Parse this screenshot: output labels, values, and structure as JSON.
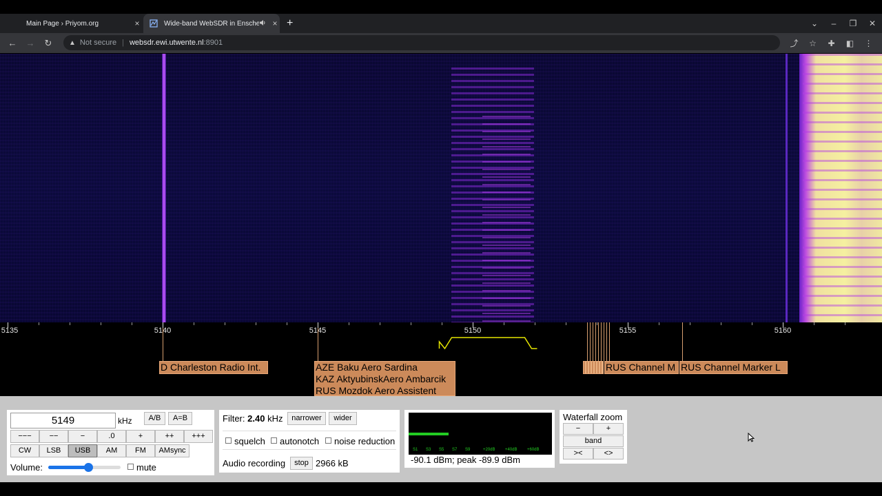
{
  "browser": {
    "tabs": [
      {
        "title": "Main Page › Priyom.org",
        "active": false,
        "close": "×"
      },
      {
        "title": "Wide-band WebSDR in Enschede",
        "active": true,
        "close": "×"
      }
    ],
    "new_tab": "+",
    "address": {
      "not_secure": "Not secure",
      "host": "websdr.ewi.utwente.nl",
      "port": ":8901"
    }
  },
  "icons": {
    "back": "back-arrow-icon",
    "forward": "forward-arrow-icon",
    "reload": "reload-icon",
    "warning": "warning-triangle-icon",
    "share": "share-icon",
    "star": "star-icon",
    "extensions": "puzzle-icon",
    "sidepanel": "side-panel-icon",
    "menu": "kebab-menu-icon",
    "speaker": "speaker-icon",
    "favicon": "websdr-favicon"
  },
  "scale": {
    "unit": "kHz",
    "min_khz": 5135,
    "max_khz": 5162.5,
    "major_ticks": [
      "5135",
      "5140",
      "5145",
      "5150",
      "5155",
      "5160"
    ],
    "passband": {
      "low_khz": 5149.1,
      "high_khz": 5151.9
    }
  },
  "stations": [
    {
      "label": "D Charleston Radio Int.",
      "freq_khz": 5140
    },
    {
      "labels": [
        "AZE Baku Aero Sardina",
        "KAZ AktyubinskAero Ambarcik",
        "RUS Mozdok Aero Assistent"
      ],
      "freq_khz": 5145
    },
    {
      "label": "RUS Channel M",
      "freq_khz": 5154
    },
    {
      "label": "RUS Channel Marker L",
      "freq_khz": 5156.3
    }
  ],
  "controls": {
    "frequency": "5149",
    "freq_unit": "kHz",
    "ab": "A/B",
    "aeqb": "A=B",
    "steps": [
      "−−−",
      "−−",
      "−",
      ".0",
      "+",
      "++",
      "+++"
    ],
    "modes": [
      "CW",
      "LSB",
      "USB",
      "AM",
      "FM",
      "AMsync"
    ],
    "active_mode": "USB",
    "volume_label": "Volume:",
    "volume_level": 0.55,
    "mute": "mute",
    "filter_label": "Filter:",
    "filter_value": "2.40",
    "filter_unit": "kHz",
    "narrower": "narrower",
    "wider": "wider",
    "squelch": "squelch",
    "autonotch": "autonotch",
    "noise_reduction": "noise reduction",
    "audio_recording": "Audio recording",
    "stop": "stop",
    "recorded_size": "2966 kB",
    "smeter_readout": "-90.1 dBm; peak  -89.9 dBm",
    "smeter_scale": [
      "S1",
      "S3",
      "S5",
      "S7",
      "S9",
      "+20dB",
      "+40dB",
      "+60dB"
    ],
    "smeter_level": 0.28,
    "waterfall_zoom": "Waterfall zoom",
    "zoom_minus": "−",
    "zoom_plus": "+",
    "band": "band",
    "zoom_in": "><",
    "zoom_out": "<>"
  },
  "colors": {
    "waterfall_bg": "#0a0836",
    "signal_strong": "#f5f0a0",
    "signal_mid": "#b040e0",
    "station_label": "#cc8a5a",
    "passband": "#e6e600",
    "smeter_bar": "#22cc22",
    "smeter_text": "#22cc22"
  }
}
